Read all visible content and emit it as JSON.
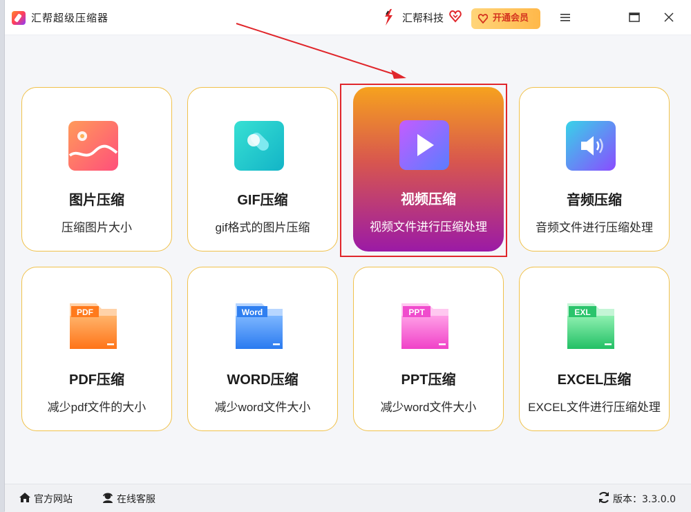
{
  "app": {
    "title": "汇帮超级压缩器"
  },
  "header": {
    "brand_name": "汇帮科技",
    "vip_label": "开通会员",
    "menu_icon": "menu-icon",
    "maximize_icon": "maximize-icon",
    "close_icon": "close-icon"
  },
  "cards": [
    {
      "name": "图片压缩",
      "desc": "压缩图片大小",
      "icon": "image-icon"
    },
    {
      "name": "GIF压缩",
      "desc": "gif格式的图片压缩",
      "icon": "gif-icon"
    },
    {
      "name": "视频压缩",
      "desc": "视频文件进行压缩处理",
      "icon": "video-play-icon"
    },
    {
      "name": "音频压缩",
      "desc": "音频文件进行压缩处理",
      "icon": "audio-speaker-icon"
    },
    {
      "name": "PDF压缩",
      "desc": "减少pdf文件的大小",
      "icon": "pdf-folder-icon",
      "badge": "PDF"
    },
    {
      "name": "WORD压缩",
      "desc": "减少word文件大小",
      "icon": "word-folder-icon",
      "badge": "Word"
    },
    {
      "name": "PPT压缩",
      "desc": "减少word文件大小",
      "icon": "ppt-folder-icon",
      "badge": "PPT"
    },
    {
      "name": "EXCEL压缩",
      "desc": "EXCEL文件进行压缩处理",
      "icon": "excel-folder-icon",
      "badge": "EXL"
    }
  ],
  "footer": {
    "website": "官方网站",
    "support": "在线客服",
    "version": "版本：3.3.0.0"
  },
  "colors": {
    "accent_border": "#f0c14a",
    "highlight_red": "#e0262b",
    "vip_text": "#d4341f"
  }
}
